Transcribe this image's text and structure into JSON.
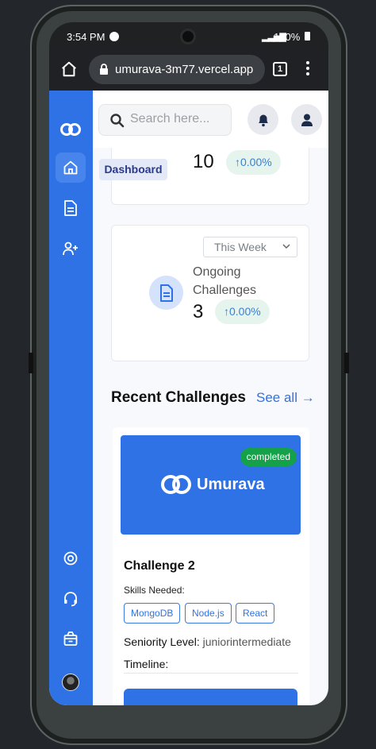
{
  "status": {
    "time": "3:54 PM",
    "battery": "100%"
  },
  "browser": {
    "url": "umurava-3m77.vercel.app",
    "tab_count": "1"
  },
  "topbar": {
    "search_placeholder": "Search here..."
  },
  "sidebar": {
    "tooltip": "Dashboard"
  },
  "stats": [
    {
      "value": "10",
      "change": "↑0.00%"
    },
    {
      "filter": "This Week",
      "label_line1": "Ongoing",
      "label_line2": "Challenges",
      "value": "3",
      "change": "↑0.00%"
    }
  ],
  "recent": {
    "title": "Recent Challenges",
    "see_all": "See all →"
  },
  "challenge": {
    "status": "completed",
    "brand": "Umurava",
    "title": "Challenge 2",
    "skills_label": "Skills Needed:",
    "skills": [
      "MongoDB",
      "Node.js",
      "React"
    ],
    "seniority_label": "Seniority Level:",
    "seniority_value": "juniorintermediate",
    "timeline_label": "Timeline:"
  },
  "colors": {
    "primary": "#2f72e6",
    "success": "#15a04a",
    "badge_bg": "#e6f4ee"
  }
}
